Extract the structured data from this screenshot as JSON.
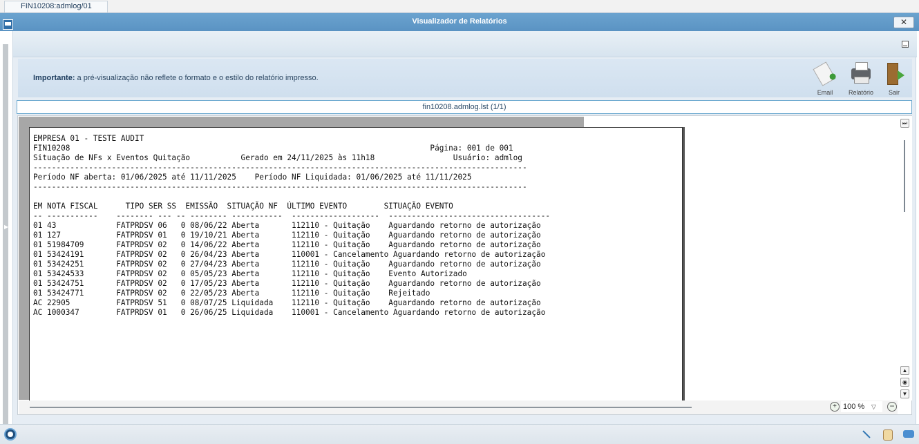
{
  "tab": {
    "label": "FIN10208:admlog/01"
  },
  "window": {
    "title": "Visualizador de Relatórios",
    "close_glyph": "✕"
  },
  "info": {
    "important_label": "Importante:",
    "important_text": " a pré-visualização não reflete o formato e o estilo do relatório impresso."
  },
  "toolbar": {
    "email_label": "Email",
    "report_label": "Relatório",
    "exit_label": "Sair"
  },
  "file": {
    "name": "fin10208.admlog.lst (1/1)"
  },
  "report": {
    "lines": [
      "EMPRESA 01 - TESTE AUDIT",
      "FIN10208                                                                              Página: 001 de 001",
      "Situação de NFs x Eventos Quitação           Gerado em 24/11/2025 às 11h18                 Usuário: admlog",
      "-----------------------------------------------------------------------------------------------------------",
      "Período NF aberta: 01/06/2025 até 11/11/2025    Período NF Liquidada: 01/06/2025 até 11/11/2025",
      "-----------------------------------------------------------------------------------------------------------",
      "",
      "EM NOTA FISCAL      TIPO SER SS  EMISSÃO  SITUAÇÃO NF  ÚLTIMO EVENTO        SITUAÇÃO EVENTO",
      "-- -----------    -------- --- -- -------- -----------  -------------------  -----------------------------------",
      "01 43             FATPRDSV 06   0 08/06/22 Aberta       112110 - Quitação    Aguardando retorno de autorização",
      "01 127            FATPRDSV 01   0 19/10/21 Aberta       112110 - Quitação    Aguardando retorno de autorização",
      "01 51984709       FATPRDSV 02   0 14/06/22 Aberta       112110 - Quitação    Aguardando retorno de autorização",
      "01 53424191       FATPRDSV 02   0 26/04/23 Aberta       110001 - Cancelamento Aguardando retorno de autorização",
      "01 53424251       FATPRDSV 02   0 27/04/23 Aberta       112110 - Quitação    Aguardando retorno de autorização",
      "01 53424533       FATPRDSV 02   0 05/05/23 Aberta       112110 - Quitação    Evento Autorizado",
      "01 53424751       FATPRDSV 02   0 17/05/23 Aberta       112110 - Quitação    Aguardando retorno de autorização",
      "01 53424771       FATPRDSV 02   0 22/05/23 Aberta       112110 - Quitação    Rejeitado",
      "AC 22905          FATPRDSV 51   0 08/07/25 Liquidada    112110 - Quitação    Aguardando retorno de autorização",
      "AC 1000347        FATPRDSV 01   0 26/06/25 Liquidada    110001 - Cancelamento Aguardando retorno de autorização"
    ]
  },
  "zoom": {
    "value": "100 %"
  },
  "icons": {
    "window": "window-icon",
    "close": "close-icon",
    "minimize": "minimize-icon",
    "email": "email-icon",
    "print": "printer-icon",
    "exit": "exit-door-icon",
    "zoom_in": "zoom-in-icon",
    "zoom_out": "zoom-out-icon"
  }
}
